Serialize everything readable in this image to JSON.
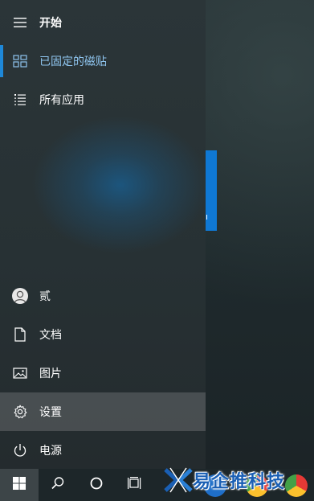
{
  "start_menu": {
    "title": "开始",
    "nav": {
      "pinned_label": "已固定的磁贴",
      "all_apps_label": "所有应用"
    },
    "bottom": {
      "user_label": "贰",
      "documents_label": "文档",
      "pictures_label": "图片",
      "settings_label": "设置",
      "power_label": "电源"
    },
    "tile_glyph": "ı"
  },
  "watermark": {
    "text": "易企推科技"
  },
  "colors": {
    "accent": "#1e88d8",
    "pinned_text": "#8ec4ee",
    "tile": "#0f78d4",
    "watermark": "#1a5fb4"
  },
  "icons": {
    "header": "hamburger-icon",
    "pinned": "tiles-icon",
    "all_apps": "list-icon",
    "user": "user-avatar-icon",
    "documents": "document-icon",
    "pictures": "picture-icon",
    "settings": "gear-icon",
    "power": "power-icon",
    "start": "windows-logo-icon",
    "search": "search-icon",
    "cortana": "cortana-circle-icon",
    "taskview": "task-view-icon"
  }
}
